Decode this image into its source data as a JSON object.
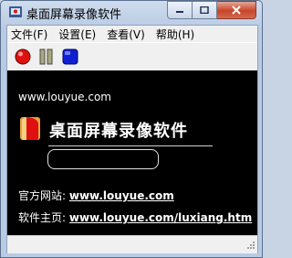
{
  "window": {
    "title": "桌面屏幕录像软件"
  },
  "menu": {
    "items": [
      {
        "label": "文件(F)"
      },
      {
        "label": "设置(E)"
      },
      {
        "label": "查看(V)"
      },
      {
        "label": "帮助(H)"
      }
    ]
  },
  "toolbar": {
    "buttons": [
      {
        "icon": "record-icon",
        "color": "#e01010"
      },
      {
        "icon": "pause-icon",
        "color": "#8a8a70"
      },
      {
        "icon": "stop-icon",
        "color": "#1020d0"
      }
    ]
  },
  "content": {
    "url_top": "www.louyue.com",
    "app_name": "桌面屏幕录像软件",
    "official_label": "官方网站:",
    "official_url": "www.louyue.com",
    "home_label": "软件主页:",
    "home_url": "www.louyue.com/luxiang.htm"
  },
  "colors": {
    "background": "#000000",
    "accent": "#e01010"
  }
}
